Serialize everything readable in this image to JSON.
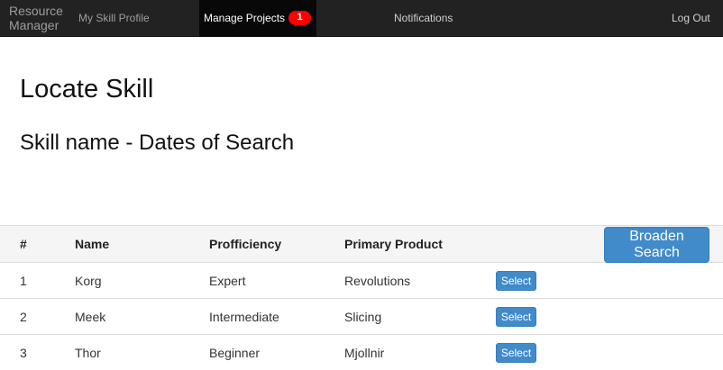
{
  "navbar": {
    "brand": "Resource Manager",
    "items": [
      {
        "label": "My Skill Profile"
      },
      {
        "label": "Manage Projects",
        "badge": "1"
      },
      {
        "label": "Notifications"
      },
      {
        "label": "Log Out"
      }
    ]
  },
  "page": {
    "title": "Locate Skill",
    "subtitle": "Skill name - Dates of Search"
  },
  "table": {
    "headers": [
      "#",
      "Name",
      "Profficiency",
      "Primary Product"
    ],
    "broaden_label": "Broaden Search",
    "select_label": "Select",
    "rows": [
      {
        "num": "1",
        "name": "Korg",
        "proficiency": "Expert",
        "product": "Revolutions"
      },
      {
        "num": "2",
        "name": "Meek",
        "proficiency": "Intermediate",
        "product": "Slicing"
      },
      {
        "num": "3",
        "name": "Thor",
        "proficiency": "Beginner",
        "product": "Mjollnir"
      }
    ]
  },
  "colors": {
    "navbar_bg": "#222222",
    "active_nav_bg": "#080808",
    "badge": "#ff0000",
    "primary_button": "#428bca"
  }
}
